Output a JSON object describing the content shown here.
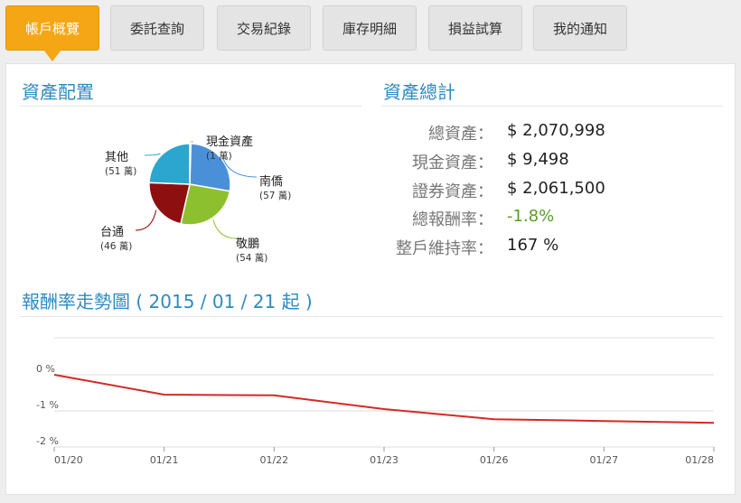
{
  "tabs": [
    {
      "label": "帳戶概覽",
      "active": true
    },
    {
      "label": "委託查詢"
    },
    {
      "label": "交易紀錄"
    },
    {
      "label": "庫存明細"
    },
    {
      "label": "損益試算"
    },
    {
      "label": "我的通知"
    }
  ],
  "allocation": {
    "title": "資產配置",
    "slices": [
      {
        "name": "現金資產",
        "amount_label": "(1 萬)",
        "value": 1,
        "color": "#e8a33a"
      },
      {
        "name": "南僑",
        "amount_label": "(57 萬)",
        "value": 57,
        "color": "#4a90d9"
      },
      {
        "name": "敬鵬",
        "amount_label": "(54 萬)",
        "value": 54,
        "color": "#8dc02e"
      },
      {
        "name": "台通",
        "amount_label": "(46 萬)",
        "value": 46,
        "color": "#8e0f0f"
      },
      {
        "name": "其他",
        "amount_label": "(51 萬)",
        "value": 51,
        "color": "#2ba6cf"
      }
    ]
  },
  "summary": {
    "title": "資產總計",
    "rows": [
      {
        "label": "總資產：",
        "value": "$ 2,070,998"
      },
      {
        "label": "現金資產：",
        "value": "$ 9,498"
      },
      {
        "label": "證券資產：",
        "value": "$ 2,061,500"
      },
      {
        "label": "總報酬率：",
        "value": "-1.8%",
        "status": "negative"
      },
      {
        "label": "整戶維持率：",
        "value": "167 %"
      }
    ]
  },
  "trend": {
    "title": "報酬率走勢圖 ( 2015 / 01 / 21 起 )"
  },
  "chart_data": {
    "type": "line",
    "x": [
      "01/20",
      "01/21",
      "01/22",
      "01/23",
      "01/26",
      "01/27",
      "01/28"
    ],
    "series": [
      {
        "values": [
          0.0,
          -0.55,
          -0.57,
          -0.95,
          -1.23,
          -1.28,
          -1.33
        ],
        "color": "#d42a25"
      }
    ],
    "y_ticks": [
      "0 %",
      "-1 %",
      "-2 %"
    ],
    "ylim": [
      -2,
      0
    ],
    "grid": true
  }
}
